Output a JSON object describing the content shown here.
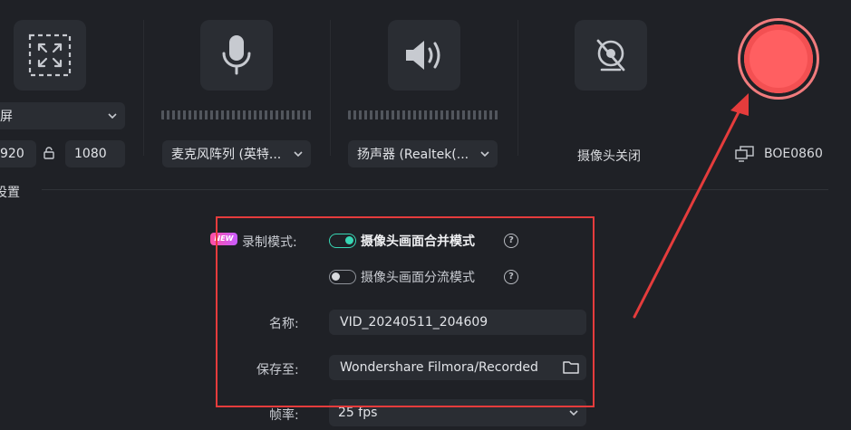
{
  "toolbar": {
    "screen": {
      "icon": "fullscreen-region-icon",
      "mode_label": "屏",
      "width_value": "920",
      "lock_icon": "aspect-lock-icon",
      "height_value": "1080"
    },
    "microphone": {
      "icon": "microphone-icon",
      "device_label": "麦克风阵列 (英特..."
    },
    "speaker": {
      "icon": "speaker-icon",
      "device_label": "扬声器 (Realtek(..."
    },
    "camera": {
      "icon": "camera-off-icon",
      "status_label": "摄像头关闭"
    },
    "record": {
      "icon": "record-button-icon",
      "monitor_icon": "monitor-icon",
      "monitor_label": "BOE0860"
    }
  },
  "settings": {
    "section_label": "设置",
    "new_badge": "NEW",
    "record_mode_label": "录制模式:",
    "mode_merge_label": "摄像头画面合并模式",
    "mode_merge_on": true,
    "mode_split_label": "摄像头画面分流模式",
    "mode_split_on": false,
    "help_glyph": "?",
    "name_label": "名称:",
    "name_value": "VID_20240511_204609",
    "save_label": "保存至:",
    "save_value": "Wondershare Filmora/Recorded",
    "fps_label": "帧率:",
    "fps_value": "25 fps"
  },
  "colors": {
    "background": "#1f2126",
    "panel": "#2a2d33",
    "accent_toggle": "#38d6b4",
    "record_red": "#ff5f61",
    "annotation_red": "#e53c3c"
  }
}
